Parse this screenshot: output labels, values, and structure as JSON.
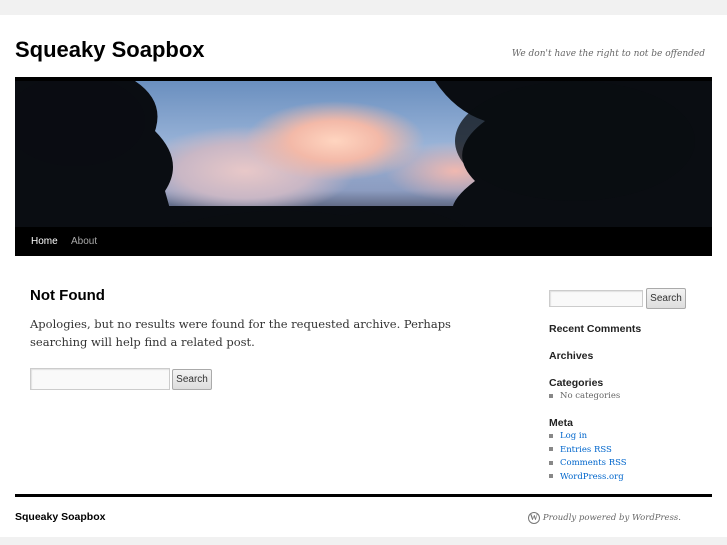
{
  "site": {
    "title": "Squeaky Soapbox",
    "tagline": "We don't have the right to not be offended"
  },
  "nav": {
    "items": [
      {
        "label": "Home"
      },
      {
        "label": "About"
      }
    ]
  },
  "main": {
    "title": "Not Found",
    "message": "Apologies, but no results were found for the requested archive. Perhaps searching will help find a related post.",
    "search_button": "Search"
  },
  "sidebar": {
    "search_button": "Search",
    "recent_comments": "Recent Comments",
    "archives": "Archives",
    "categories": {
      "title": "Categories",
      "items": [
        "No categories"
      ]
    },
    "meta": {
      "title": "Meta",
      "items": [
        "Log in",
        "Entries RSS",
        "Comments RSS",
        "WordPress.org"
      ]
    }
  },
  "footer": {
    "site_title": "Squeaky Soapbox",
    "powered": "Proudly powered by WordPress.",
    "wp_logo": "W"
  }
}
